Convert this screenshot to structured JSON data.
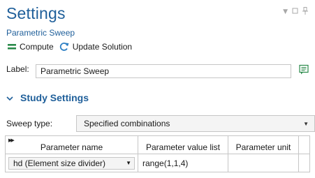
{
  "header": {
    "title": "Settings",
    "subtitle": "Parametric Sweep"
  },
  "toolbar": {
    "compute_label": "Compute",
    "update_label": "Update Solution"
  },
  "label_field": {
    "label": "Label:",
    "value": "Parametric Sweep"
  },
  "section": {
    "title": "Study Settings"
  },
  "sweep": {
    "label": "Sweep type:",
    "value": "Specified combinations"
  },
  "table": {
    "headers": [
      "Parameter name",
      "Parameter value list",
      "Parameter unit"
    ],
    "rows": [
      {
        "name": "hd (Element size divider)",
        "values": "range(1,1,4)",
        "unit": ""
      }
    ]
  },
  "colors": {
    "accent": "#1f5f9a",
    "compute_icon": "#2a8a4a",
    "update_icon": "#2c7fc4"
  }
}
